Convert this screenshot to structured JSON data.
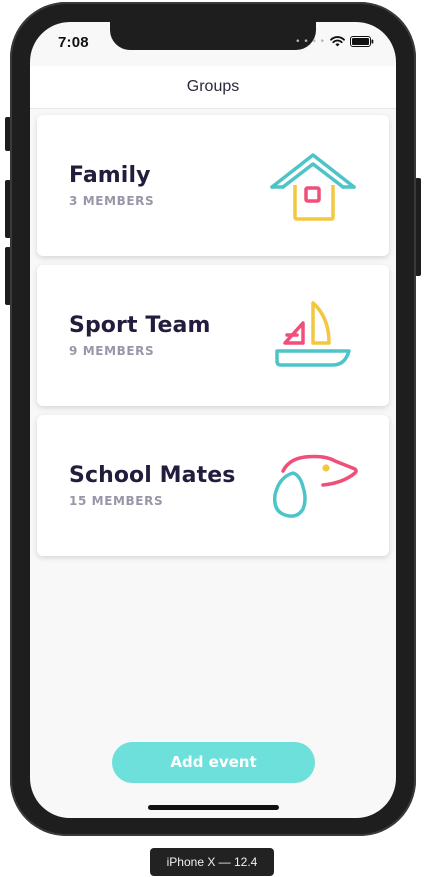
{
  "status_bar": {
    "time": "7:08",
    "signal_icon": "signal-dots-icon",
    "wifi_icon": "wifi-icon",
    "battery_icon": "battery-icon"
  },
  "nav": {
    "title": "Groups"
  },
  "groups": [
    {
      "name": "Family",
      "members": "3 MEMBERS",
      "icon": "house-icon"
    },
    {
      "name": "Sport Team",
      "members": "9 MEMBERS",
      "icon": "sailboat-icon"
    },
    {
      "name": "School Mates",
      "members": "15 MEMBERS",
      "icon": "dog-icon"
    }
  ],
  "actions": {
    "add_event_label": "Add event"
  },
  "device": {
    "label": "iPhone X — 12.4"
  },
  "colors": {
    "accent": "#6ee0dc",
    "teal_icon": "#4cc4c8",
    "yellow_icon": "#f3c73e",
    "pink_icon": "#ef4f78",
    "title_text": "#231c3c",
    "subtitle_text": "#9a96a8"
  }
}
